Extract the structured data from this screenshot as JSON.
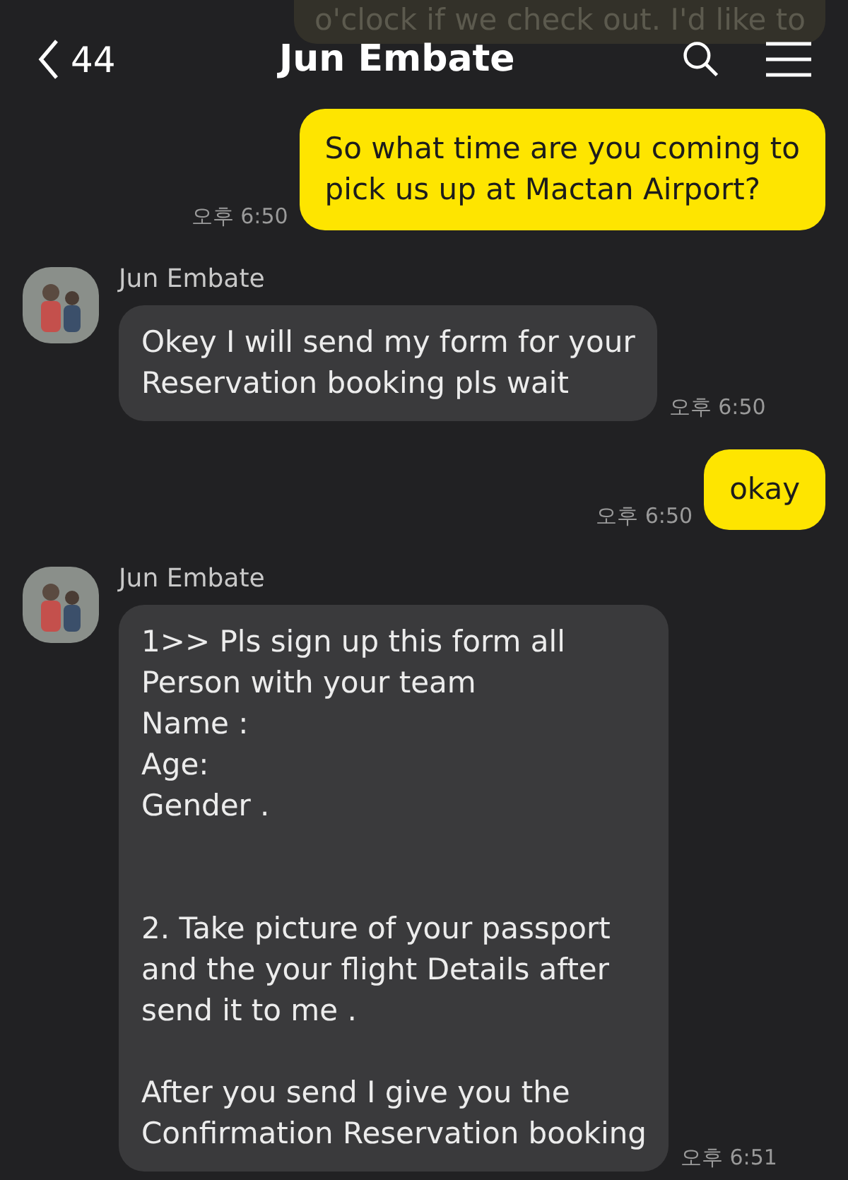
{
  "header": {
    "back_count": "44",
    "title": "Jun Embate"
  },
  "messages": [
    {
      "kind": "faded",
      "lines": [
        "o'clock if we check out. I'd like to"
      ]
    },
    {
      "kind": "me",
      "lines": [
        "So what time are you coming to",
        "pick us up at Mactan Airport?"
      ],
      "time": "오후 6:50"
    },
    {
      "kind": "other",
      "sender": "Jun Embate",
      "paragraphs": [
        [
          "Okey I will send my form for your",
          "Reservation booking pls wait"
        ]
      ],
      "time": "오후 6:50"
    },
    {
      "kind": "me",
      "lines": [
        "okay"
      ],
      "time": "오후 6:50"
    },
    {
      "kind": "other",
      "sender": "Jun Embate",
      "paragraphs": [
        [
          "1>> Pls sign up this form all",
          "Person with your team",
          "Name :",
          "Age:",
          "Gender ."
        ],
        [
          "2. Take picture of your passport",
          "and the your flight Details after",
          "send it to me ."
        ],
        [
          "After you send I give you the",
          "Confirmation Reservation booking"
        ]
      ],
      "time": "오후 6:51"
    }
  ]
}
